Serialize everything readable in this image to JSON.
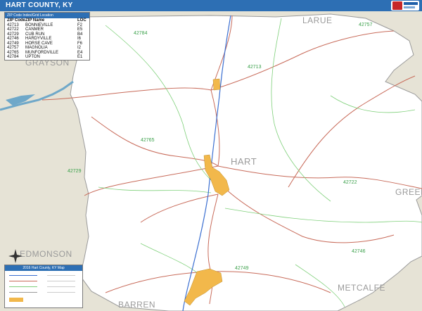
{
  "header": {
    "title": "HART COUNTY, KY"
  },
  "zip_table": {
    "title": "ZIP Code Index/Grid Location",
    "columns": [
      "ZIP Code",
      "ZIP Name",
      "LOC"
    ],
    "rows": [
      [
        "42713",
        "BONNIEVILLE",
        "F2"
      ],
      [
        "42722",
        "CANMER",
        "E5"
      ],
      [
        "42729",
        "CUB RUN",
        "B4"
      ],
      [
        "42746",
        "HARDYVILLE",
        "I6"
      ],
      [
        "42749",
        "HORSE CAVE",
        "F6"
      ],
      [
        "42757",
        "MAGNOLIA",
        "I2"
      ],
      [
        "42765",
        "MUNFORDVILLE",
        "E4"
      ],
      [
        "42784",
        "UPTON",
        "E1"
      ]
    ]
  },
  "legend": {
    "title": "2016 Hart County, KY Map"
  },
  "map": {
    "neighbor_counties": {
      "larue": "LARUE",
      "grayson": "GRAYSON",
      "green": "GREEN",
      "edmonson": "EDMONSON",
      "barren": "BARREN",
      "metcalfe": "METCALFE"
    },
    "county_center_label": "HART",
    "zip_labels": {
      "z42784": "42784",
      "z42757": "42757",
      "z42713": "42713",
      "z42765": "42765",
      "z42729": "42729",
      "z42722": "42722",
      "z42746": "42746",
      "z42749": "42749"
    },
    "colors": {
      "title_bar": "#2d6fb4",
      "county_fill": "#ffffff",
      "outside_fill": "#e6e3d6",
      "water": "#6fa8c9",
      "urban": "#f2b84b",
      "roads": "#c86b5a",
      "zip_boundaries": "#7fd07a",
      "interstate": "#3b6fd1"
    }
  }
}
